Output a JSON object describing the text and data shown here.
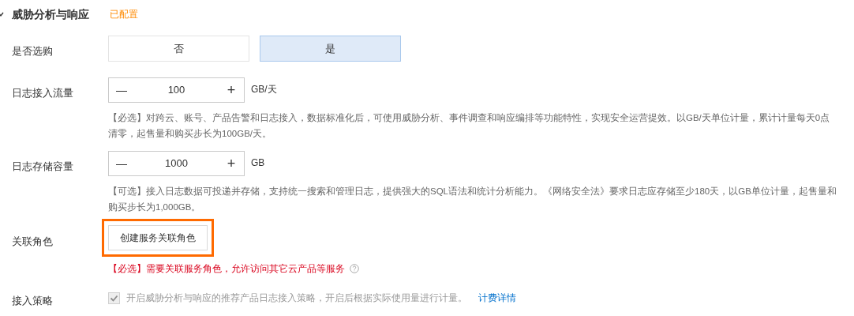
{
  "section": {
    "title": "威胁分析与响应",
    "status": "已配置",
    "expanded": true
  },
  "rows": [
    {
      "kind": "choice",
      "label": "是否选购",
      "options": [
        {
          "label": "否",
          "selected": false
        },
        {
          "label": "是",
          "selected": true
        }
      ]
    },
    {
      "kind": "stepper",
      "label": "日志接入流量",
      "decrement": "—",
      "value": "100",
      "increment": "+",
      "unit": "GB/天",
      "help": "【必选】对跨云、账号、产品告警和日志接入，数据标准化后，可使用威胁分析、事件调查和响应编排等功能特性，实现安全运营提效。以GB/天单位计量，累计计量每天0点清零，起售量和购买步长为100GB/天。"
    },
    {
      "kind": "stepper",
      "label": "日志存储容量",
      "decrement": "—",
      "value": "1000",
      "increment": "+",
      "unit": "GB",
      "help": "【可选】接入日志数据可投递并存储，支持统一搜索和管理日志，提供强大的SQL语法和统计分析能力。《网络安全法》要求日志应存储至少180天，以GB单位计量，起售量和购买步长为1,000GB。"
    },
    {
      "kind": "action",
      "label": "关联角色",
      "button": "创建服务关联角色",
      "highlighted": true,
      "error": "【必选】需要关联服务角色，允许访问其它云产品等服务"
    },
    {
      "kind": "checkbox",
      "label": "接入策略",
      "checked": true,
      "disabled": true,
      "text": "开启威胁分析与响应的推荐产品日志接入策略，开启后根据实际使用量进行计量。",
      "link": "计费详情"
    }
  ]
}
